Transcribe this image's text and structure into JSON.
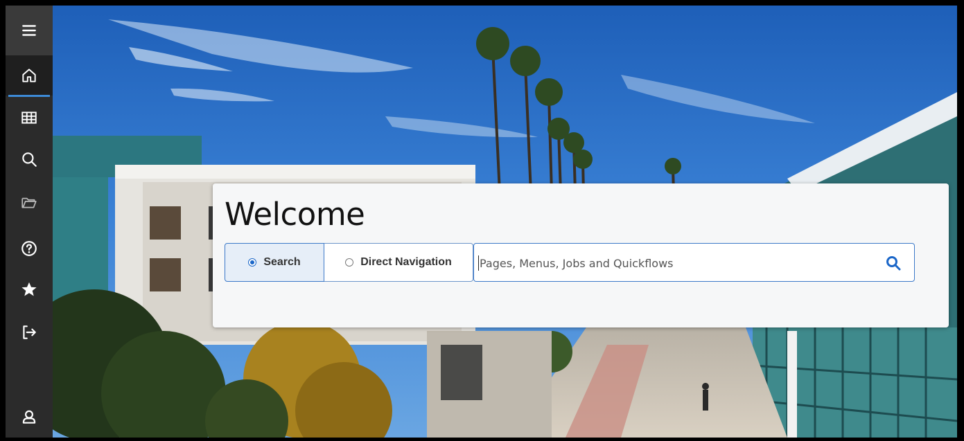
{
  "welcome": {
    "title": "Welcome"
  },
  "search_modes": {
    "search_label": "Search",
    "direct_label": "Direct Navigation",
    "selected": "Search"
  },
  "search": {
    "placeholder": "Pages, Menus, Jobs and Quickflows",
    "value": ""
  },
  "sidebar": {
    "items": [
      {
        "icon": "menu-icon"
      },
      {
        "icon": "home-icon",
        "active": true
      },
      {
        "icon": "grid-icon"
      },
      {
        "icon": "search-icon"
      },
      {
        "icon": "folder-icon"
      },
      {
        "icon": "help-icon"
      },
      {
        "icon": "star-icon"
      },
      {
        "icon": "sign-out-icon"
      },
      {
        "icon": "user-icon"
      }
    ]
  },
  "colors": {
    "accent": "#1a66c8",
    "sidebar_bg": "#2b2b2b",
    "card_bg": "#f6f7f8"
  }
}
